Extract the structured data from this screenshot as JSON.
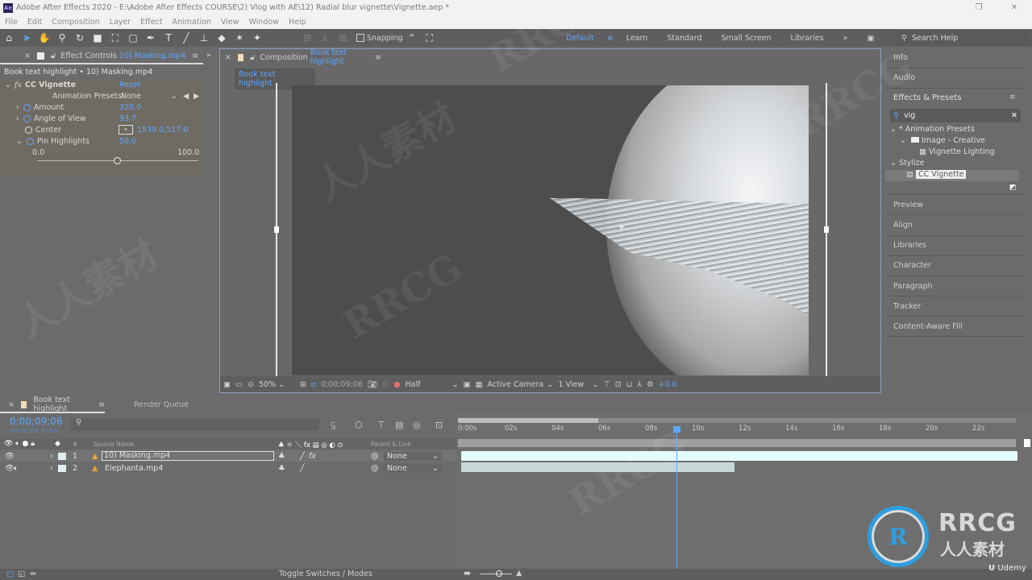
{
  "app": {
    "title": "Adobe After Effects 2020 - E:\\Adobe After Effects COURSE\\2) Vlog with AE\\12) Radial blur vignette\\Vignette.aep *",
    "icon_label": "Ae"
  },
  "menu": [
    "File",
    "Edit",
    "Composition",
    "Layer",
    "Effect",
    "Animation",
    "View",
    "Window",
    "Help"
  ],
  "toolbar": {
    "snapping_label": "Snapping"
  },
  "workspaces": {
    "items": [
      "Default",
      "Learn",
      "Standard",
      "Small Screen",
      "Libraries"
    ],
    "active": "Default",
    "search_placeholder": "Search Help"
  },
  "effect_controls": {
    "tab_label": "Effect Controls",
    "tab_file": "10) Masking.mp4",
    "breadcrumb": "Book text highlight • 10) Masking.mp4",
    "effect_name": "CC Vignette",
    "reset_label": "Reset",
    "presets_label": "Animation Presets:",
    "presets_value": "None",
    "params": [
      {
        "name": "Amount",
        "value": "320.0"
      },
      {
        "name": "Angle of View",
        "value": "93.7"
      },
      {
        "name": "Center",
        "value": "1539.0,517.0"
      },
      {
        "name": "Pin Highlights",
        "value": "50.0"
      }
    ],
    "slider": {
      "min_label": "0.0",
      "max_label": "100.0",
      "fraction": 0.5
    }
  },
  "composition": {
    "tab_label": "Composition",
    "tab_name": "Book text highlight",
    "breadcrumb": "Book text highlight",
    "footer": {
      "zoom": "50%",
      "timecode": "0;00;09;06",
      "resolution": "Half",
      "camera": "Active Camera",
      "views": "1 View",
      "exposure": "+0.0"
    }
  },
  "right_panel": {
    "items_top": [
      "Info",
      "Audio"
    ],
    "effects_title": "Effects & Presets",
    "search_value": "vig",
    "tree": [
      {
        "label": "* Animation Presets",
        "level": 0
      },
      {
        "label": "Image - Creative",
        "level": 1
      },
      {
        "label": "Vignette Lighting",
        "level": 2
      },
      {
        "label": "Stylize",
        "level": 0
      },
      {
        "label": "CC Vignette",
        "level": 1
      }
    ],
    "items_bottom": [
      "Preview",
      "Align",
      "Libraries",
      "Character",
      "Paragraph",
      "Tracker",
      "Content-Aware Fill"
    ]
  },
  "timeline": {
    "tab_label": "Book text highlight",
    "render_queue_label": "Render Queue",
    "timecode": "0;00;09;06",
    "frame_info": "00276 (29.97 fps)",
    "columns": {
      "source": "Source Name",
      "parent": "Parent & Link",
      "num": "#"
    },
    "layers": [
      {
        "num": "1",
        "name": "10) Masking.mp4",
        "parent": "None",
        "has_fx": true,
        "has_audio": false
      },
      {
        "num": "2",
        "name": "Elephanta.mp4",
        "parent": "None",
        "has_fx": false,
        "has_audio": true
      }
    ],
    "ticks": [
      "0:00s",
      "02s",
      "04s",
      "06s",
      "08s",
      "10s",
      "12s",
      "14s",
      "16s",
      "18s",
      "20s",
      "22s"
    ],
    "playhead_seconds": 9.2,
    "work_area_end_seconds": 6,
    "layer2_end_seconds": 11.7,
    "toggle_label": "Toggle Switches / Modes"
  },
  "watermark": {
    "brand": "RRCG",
    "sub": "人人素材",
    "udemy": "Udemy"
  }
}
